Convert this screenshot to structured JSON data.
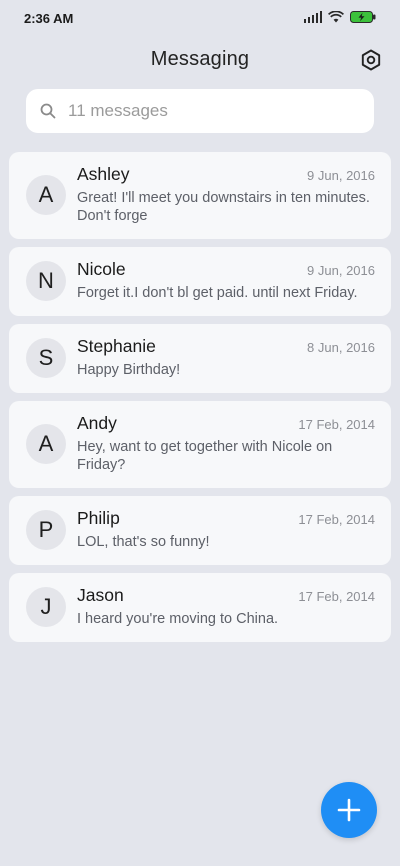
{
  "status_bar": {
    "time": "2:36 AM"
  },
  "header": {
    "title": "Messaging",
    "settings_icon": "gear-icon"
  },
  "search": {
    "placeholder": "11 messages",
    "icon": "search-icon"
  },
  "messages": [
    {
      "initial": "A",
      "name": "Ashley",
      "date": "9 Jun, 2016",
      "preview": "Great! I'll meet you downstairs in ten minutes. Don't forge"
    },
    {
      "initial": "N",
      "name": "Nicole",
      "date": "9 Jun, 2016",
      "preview": "Forget it.I don't bl get paid. until next Friday."
    },
    {
      "initial": "S",
      "name": "Stephanie",
      "date": "8 Jun, 2016",
      "preview": "Happy Birthday!"
    },
    {
      "initial": "A",
      "name": "Andy",
      "date": "17 Feb, 2014",
      "preview": "Hey, want to get together with Nicole on Friday?"
    },
    {
      "initial": "P",
      "name": "Philip",
      "date": "17 Feb, 2014",
      "preview": "LOL, that's so funny!"
    },
    {
      "initial": "J",
      "name": "Jason",
      "date": "17 Feb, 2014",
      "preview": "I heard you're moving to China."
    }
  ],
  "fab": {
    "icon": "plus-icon",
    "color": "#1f8ef5"
  },
  "colors": {
    "background": "#e3e5ec",
    "card": "#f7f8fa",
    "accent": "#1f8ef5",
    "battery": "#3cc13b"
  }
}
